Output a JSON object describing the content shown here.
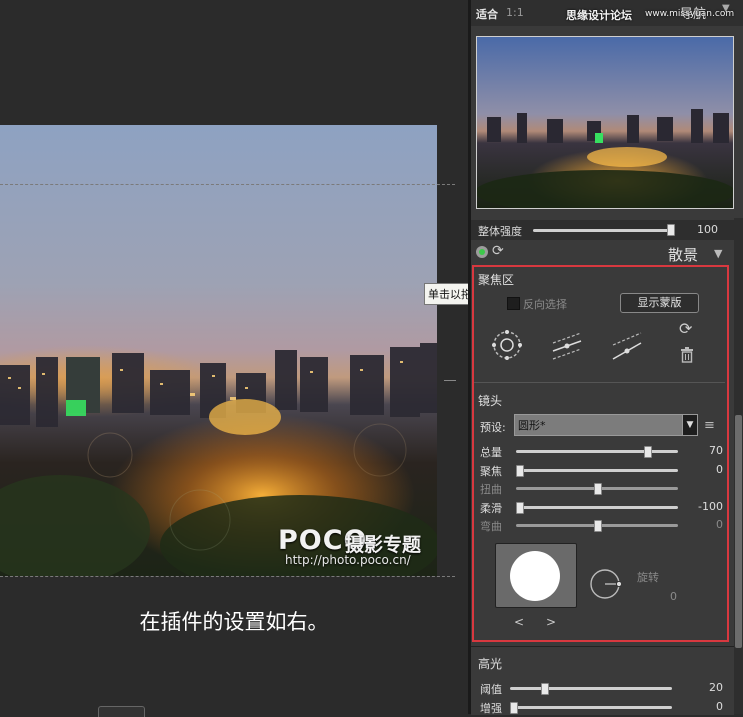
{
  "canvas": {
    "caption": "在插件的设置如右。",
    "watermark_logo": "POCO",
    "watermark_sub": "摄影专题",
    "watermark_url": "http://photo.poco.cn/",
    "tooltip": "单击以拖动此区域"
  },
  "topbar": {
    "fit_label": "适合",
    "ratio_label": "1:1",
    "navigator_label": "导航",
    "site_watermark": "思缘设计论坛",
    "site_watermark_url": "www.missyuan.com"
  },
  "strength": {
    "label": "整体强度",
    "value": "100",
    "level": 1.0
  },
  "bokeh": {
    "title": "散景",
    "focus_zone": {
      "title": "聚焦区",
      "invert_label": "反向选择",
      "show_mask": "显示蒙版",
      "tools": [
        "radial-focus-icon",
        "linear-focus-icon",
        "tilt-focus-icon"
      ]
    },
    "lens": {
      "title": "镜头",
      "preset_label": "预设:",
      "preset_value": "圆形*",
      "sliders": [
        {
          "label": "总量",
          "value": "70",
          "level": 0.82,
          "dim": false
        },
        {
          "label": "聚焦",
          "value": "0",
          "level": 0.0,
          "dim": false
        },
        {
          "label": "扭曲",
          "value": "",
          "level": 0.5,
          "dim": true
        },
        {
          "label": "柔滑",
          "value": "-100",
          "level": 0.0,
          "dim": false
        },
        {
          "label": "弯曲",
          "value": "0",
          "level": 0.5,
          "dim": true
        }
      ],
      "prev": "<",
      "next": ">",
      "rotate_label": "旋转",
      "rotate_value": "0"
    }
  },
  "highlights": {
    "title": "高光",
    "sliders": [
      {
        "label": "阈值",
        "value": "20",
        "level": 0.2
      },
      {
        "label": "增强",
        "value": "0",
        "level": 0.0
      }
    ]
  },
  "colors": {
    "accent_red": "#d8383f",
    "status_green": "#3cc84a"
  }
}
